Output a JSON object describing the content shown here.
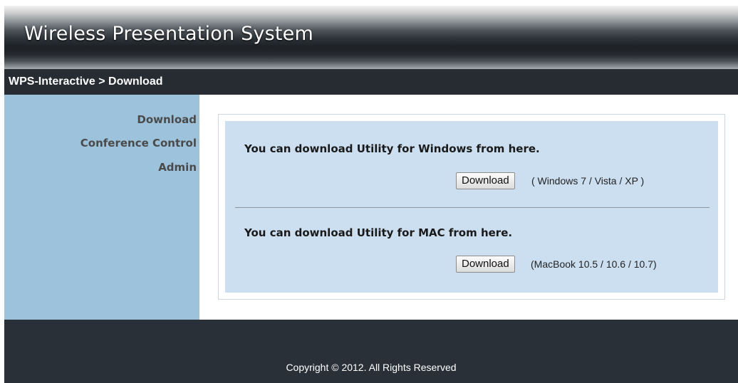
{
  "header": {
    "title": "Wireless Presentation System"
  },
  "breadcrumb": {
    "text": "WPS-Interactive > Download"
  },
  "sidebar": {
    "items": [
      {
        "label": "Download"
      },
      {
        "label": "Conference Control"
      },
      {
        "label": "Admin"
      }
    ]
  },
  "main": {
    "windows": {
      "text": "You can download Utility for Windows from here.",
      "button_label": "Download",
      "note": "( Windows 7 / Vista / XP )"
    },
    "mac": {
      "text": "You can download Utility for MAC from here.",
      "button_label": "Download",
      "note": "(MacBook 10.5 / 10.6 / 10.7)"
    }
  },
  "footer": {
    "copyright": "Copyright © 2012. All Rights Reserved"
  },
  "colors": {
    "sidebar_bg": "#9dc3dc",
    "panel_bg": "#ccdff0",
    "dark_bar": "#262c32"
  }
}
